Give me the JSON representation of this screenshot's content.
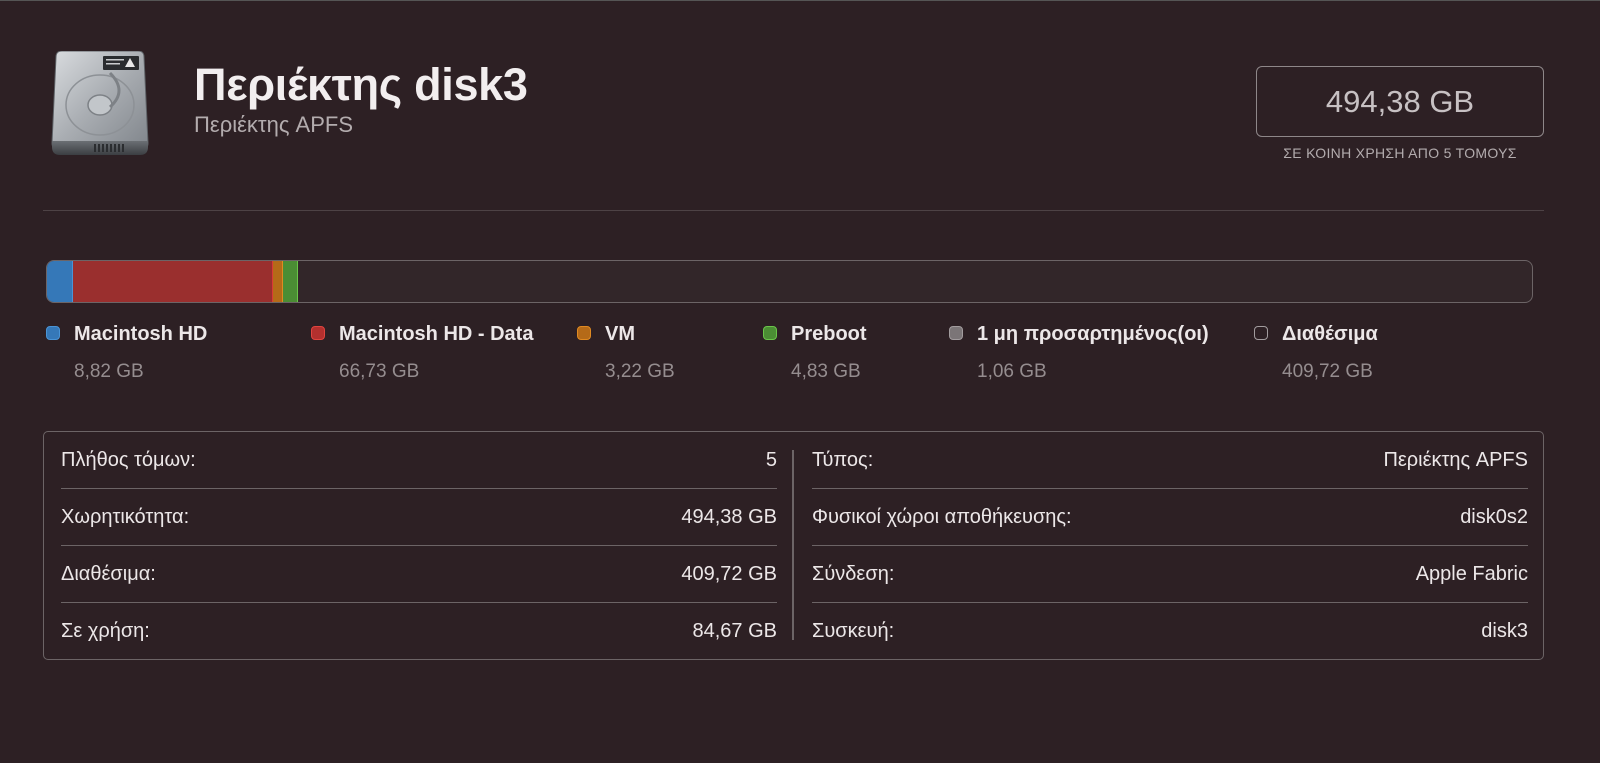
{
  "header": {
    "title": "Περιέκτης disk3",
    "subtitle": "Περιέκτης APFS",
    "icon": "hard-drive-icon",
    "capacity_value": "494,38 GB",
    "capacity_caption": "ΣΕ ΚΟΙΝΗ ΧΡΗΣΗ ΑΠΟ 5 ΤΟΜΟΥΣ"
  },
  "usage": {
    "total_gb": 494.38,
    "segments": [
      {
        "name": "Macintosh HD",
        "size_gb": 8.82,
        "color": "#3578b8",
        "border": "#4a94d6"
      },
      {
        "name": "Macintosh HD - Data",
        "size_gb": 66.73,
        "color": "#9a2f2e",
        "border": "#d93a36"
      },
      {
        "name": "VM",
        "size_gb": 3.22,
        "color": "#b56a18",
        "border": "#e08a22"
      },
      {
        "name": "Preboot",
        "size_gb": 4.83,
        "color": "#4b8d34",
        "border": "#6ac44a"
      }
    ]
  },
  "legend": [
    {
      "name": "Macintosh HD",
      "size": "8,82 GB",
      "swatch": "#3578b8",
      "border": "#4a94d6"
    },
    {
      "name": "Macintosh HD - Data",
      "size": "66,73 GB",
      "swatch": "#b3302e",
      "border": "#e0443f"
    },
    {
      "name": "VM",
      "size": "3,22 GB",
      "swatch": "#b56a18",
      "border": "#e08a22"
    },
    {
      "name": "Preboot",
      "size": "4,83 GB",
      "swatch": "#4b8d34",
      "border": "#6ac44a"
    },
    {
      "name": "1 μη προσαρτημένος(οι)",
      "size": "1,06 GB",
      "swatch": "#7b7577",
      "border": "#a29c9e"
    },
    {
      "name": "Διαθέσιμα",
      "size": "409,72 GB",
      "swatch": "#2d2024",
      "border": "#a29c9e"
    }
  ],
  "info": {
    "left": [
      {
        "label": "Πλήθος τόμων:",
        "value": "5"
      },
      {
        "label": "Χωρητικότητα:",
        "value": "494,38 GB"
      },
      {
        "label": "Διαθέσιμα:",
        "value": "409,72 GB"
      },
      {
        "label": "Σε χρήση:",
        "value": "84,67 GB"
      }
    ],
    "right": [
      {
        "label": "Τύπος:",
        "value": "Περιέκτης APFS"
      },
      {
        "label": "Φυσικοί χώροι αποθήκευσης:",
        "value": "disk0s2"
      },
      {
        "label": "Σύνδεση:",
        "value": "Apple Fabric"
      },
      {
        "label": "Συσκευή:",
        "value": "disk3"
      }
    ]
  }
}
